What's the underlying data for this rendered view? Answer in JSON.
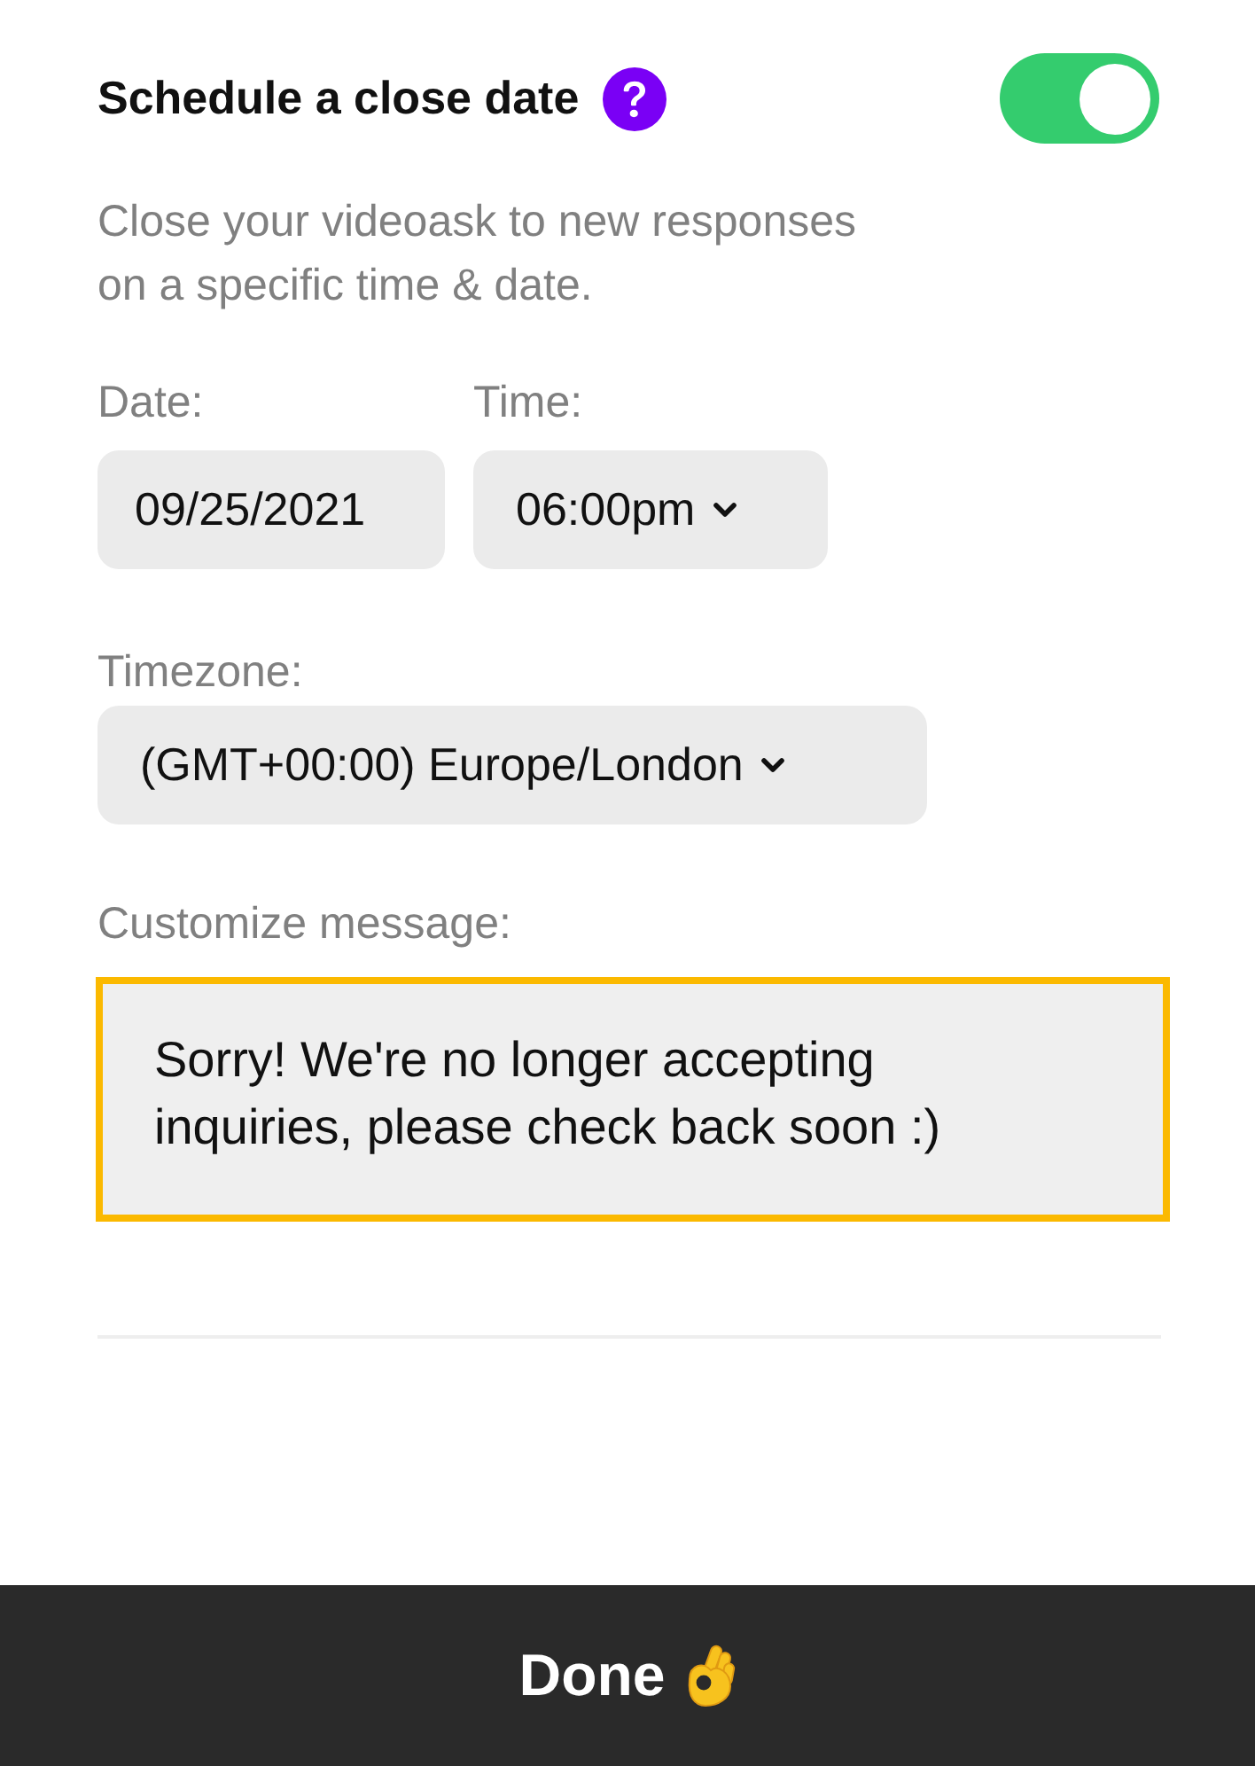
{
  "header": {
    "title": "Schedule a close date",
    "enabled": true
  },
  "description": "Close your videoask to new responses on a specific time & date.",
  "fields": [
    {
      "label": "Date:",
      "value": "09/25/2021",
      "kind": "input"
    },
    {
      "label": "Time:",
      "value": "06:00pm",
      "kind": "select"
    }
  ],
  "timezone": {
    "label": "Timezone:",
    "value": "(GMT+00:00) Europe/London"
  },
  "message": {
    "label": "Customize message:",
    "value": "Sorry! We're no longer accepting inquiries, please check back soon :)",
    "focused": true
  },
  "footer": {
    "button": "Done"
  }
}
